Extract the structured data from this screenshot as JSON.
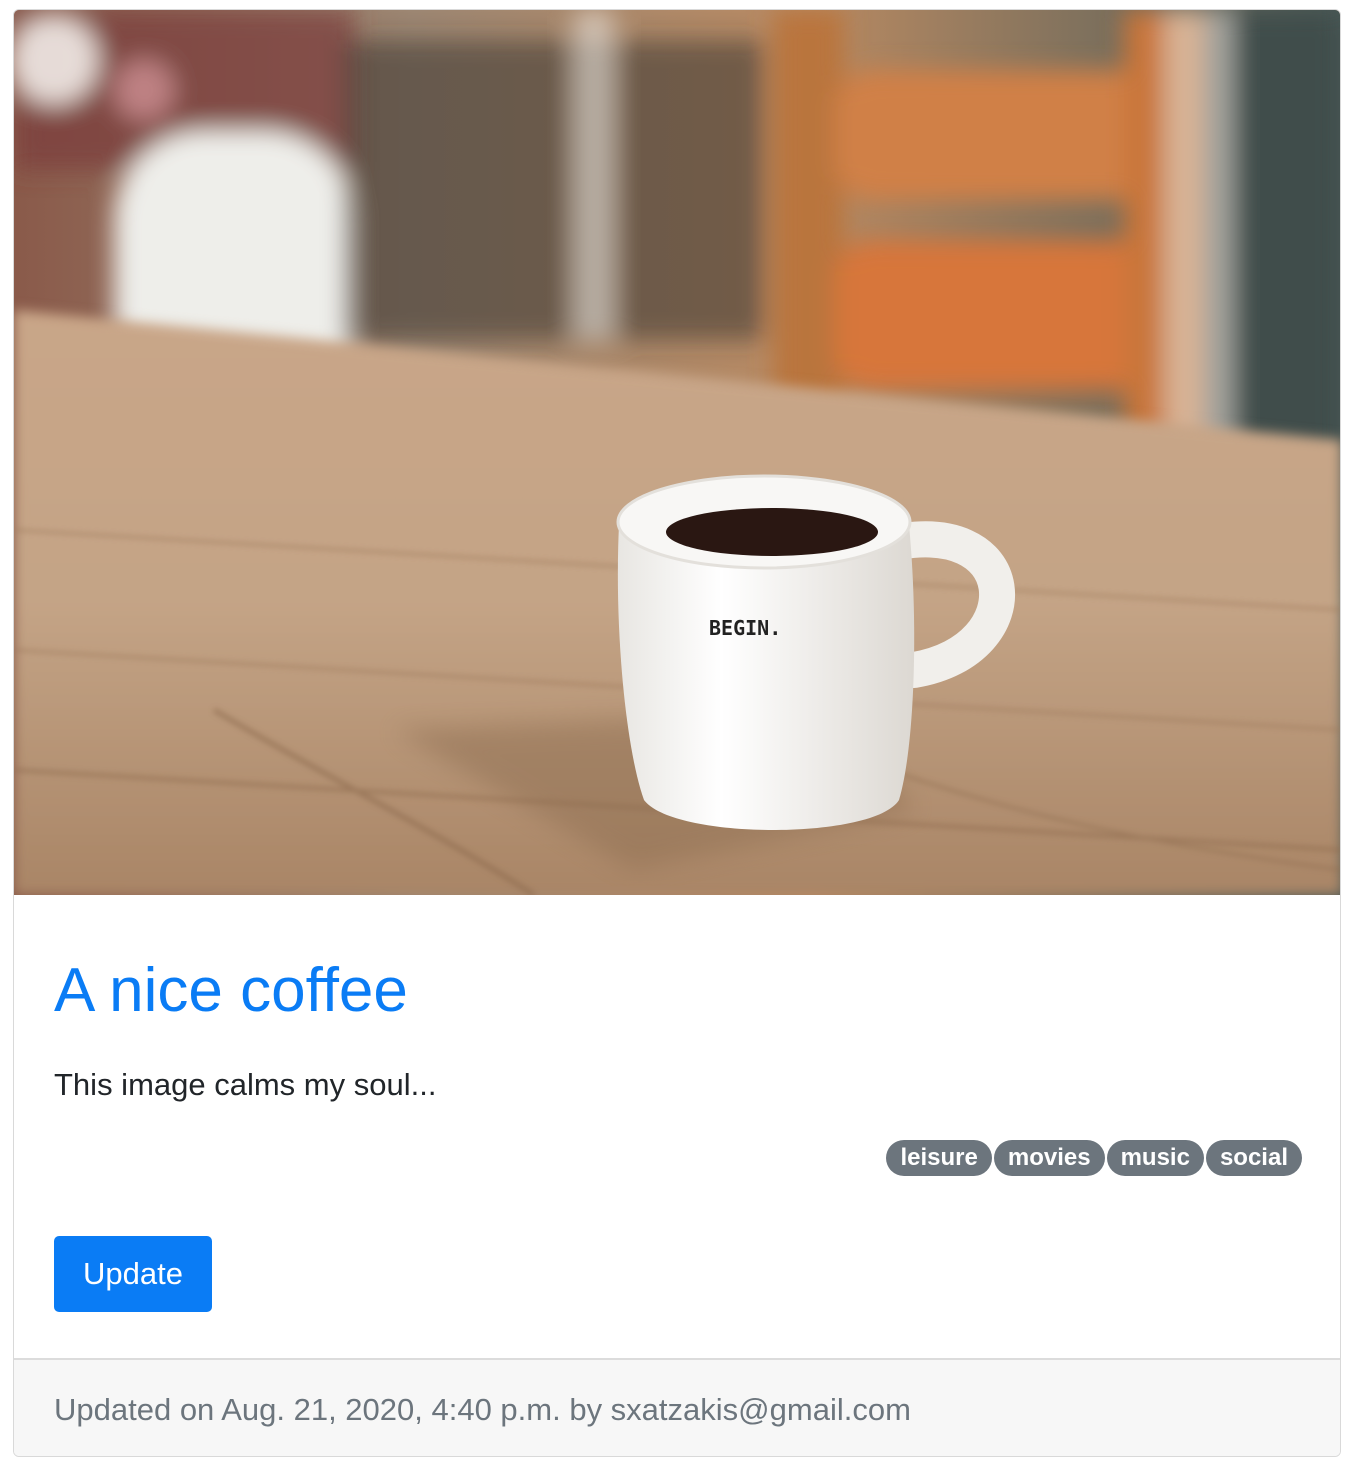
{
  "post": {
    "image_alt": "Coffee mug on a wooden table",
    "mug_text": "BEGIN.",
    "title": "A nice coffee",
    "description": "This image calms my soul...",
    "tags": [
      "leisure",
      "movies",
      "music",
      "social"
    ],
    "update_label": "Update",
    "footer": "Updated on Aug. 21, 2020, 4:40 p.m. by sxatzakis@gmail.com"
  },
  "colors": {
    "primary": "#0a7cf5",
    "tag_bg": "#6c757d",
    "footer_bg": "#f7f7f7",
    "text_dark": "#212529",
    "text_muted": "#6c757d"
  }
}
